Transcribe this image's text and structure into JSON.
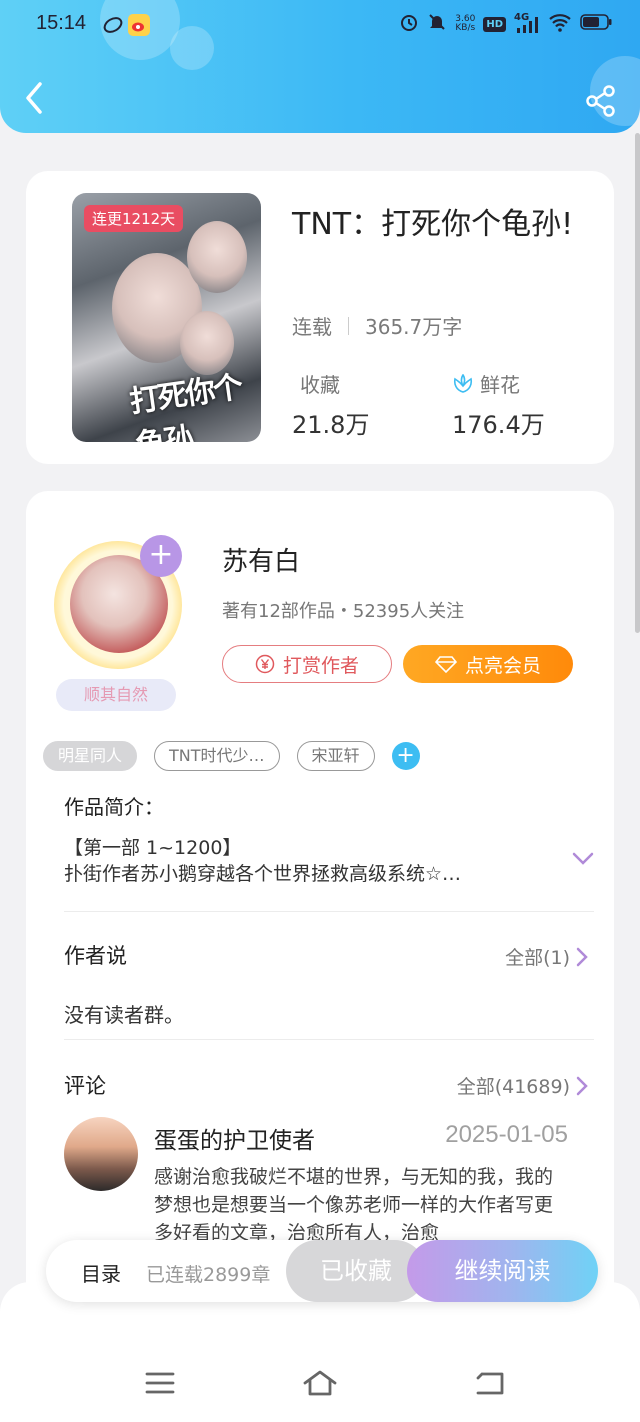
{
  "status_bar": {
    "time": "15:14",
    "net_speed_value": "3.60",
    "net_speed_unit": "KB/s",
    "hd_label": "HD",
    "signal_label": "4G"
  },
  "header": {
    "back_icon": "chevron-left-icon",
    "share_icon": "share-icon"
  },
  "book": {
    "cover_badge": "连更1212天",
    "cover_title": "打死你个龟孙",
    "title": "TNT：打死你个龟孙!",
    "status": "连载",
    "word_count": "365.7万字",
    "favorites_label": "收藏",
    "favorites_value": "21.8万",
    "flowers_label": "鲜花",
    "flowers_value": "176.4万"
  },
  "author": {
    "name": "苏有白",
    "stats": "著有12部作品・52395人关注",
    "avatar_tag": "顺其自然",
    "reward_button": "打赏作者",
    "vip_button": "点亮会员"
  },
  "tags": [
    "明星同人",
    "TNT时代少…",
    "宋亚轩"
  ],
  "synopsis": {
    "title": "作品简介：",
    "line1": "【第一部 1~1200】",
    "line2": "扑街作者苏小鹅穿越各个世界拯救高级系统☆…"
  },
  "author_says": {
    "title": "作者说",
    "see_all": "全部(1)",
    "content": "没有读者群。"
  },
  "comments": {
    "title": "评论",
    "see_all": "全部(41689)",
    "items": [
      {
        "user": "蛋蛋的护卫使者",
        "date": "2025-01-05",
        "text": "感谢治愈我破烂不堪的世界，与无知的我，我的梦想也是想要当一个像苏老师一样的大作者写更多好看的文章，治愈所有人，治愈"
      }
    ]
  },
  "bottom_bar": {
    "toc": "目录",
    "chapters": "已连载2899章",
    "favorited": "已收藏",
    "continue": "继续阅读"
  },
  "colors": {
    "header_start": "#5fd0f6",
    "header_end": "#2fa8f2",
    "accent_orange": "#ff8a0a",
    "accent_red": "#e0595d",
    "accent_blue": "#3dbdf2"
  }
}
